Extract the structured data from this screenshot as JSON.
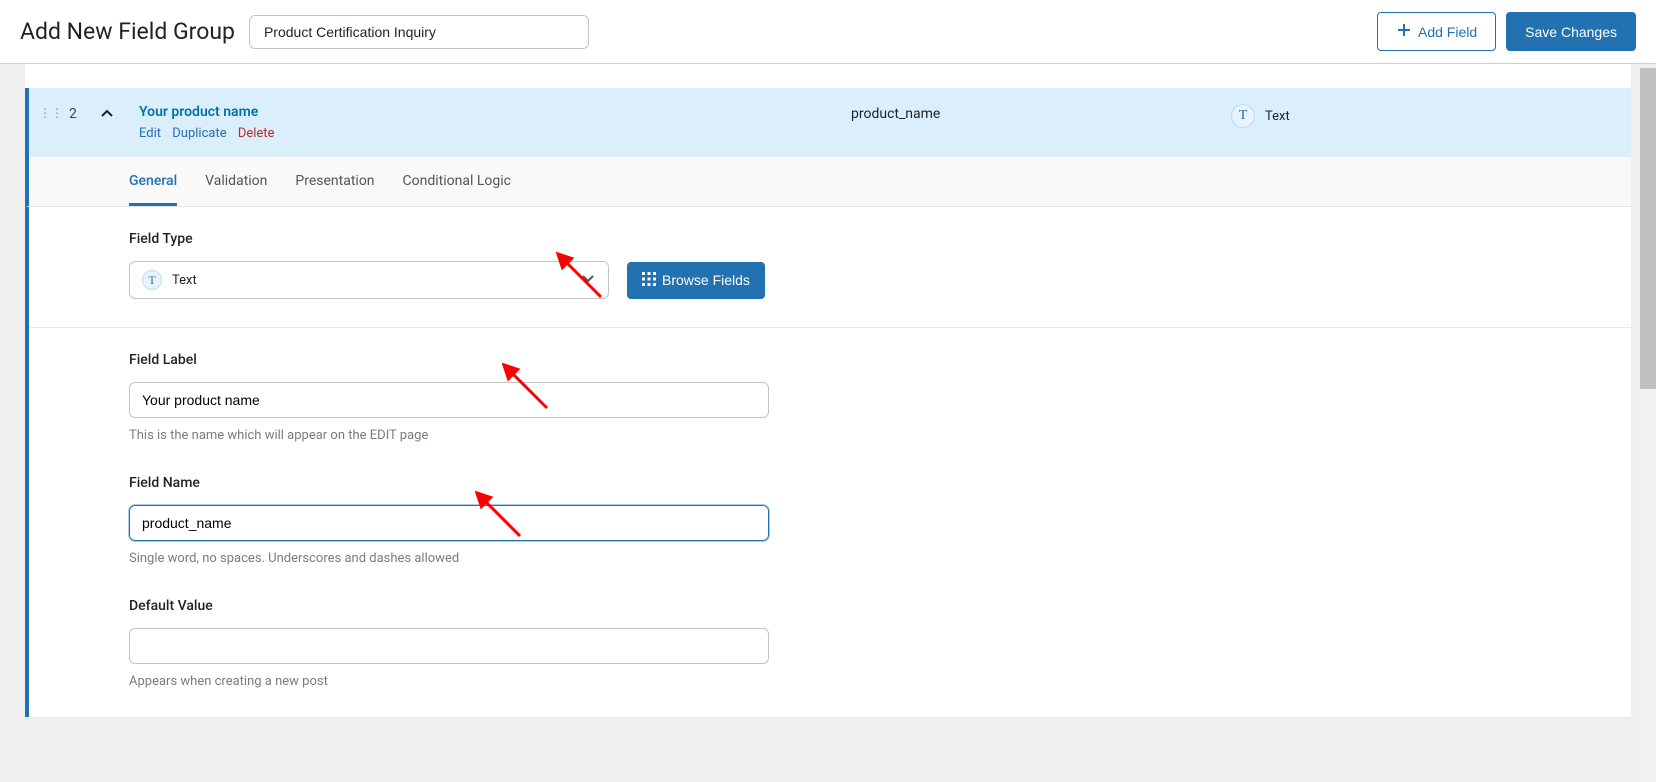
{
  "header": {
    "page_title": "Add New Field Group",
    "group_title_value": "Product Certification Inquiry",
    "add_field": "Add Field",
    "save_changes": "Save Changes"
  },
  "row": {
    "number": "2",
    "label": "Your product name",
    "actions": {
      "edit": "Edit",
      "duplicate": "Duplicate",
      "delete": "Delete"
    },
    "key": "product_name",
    "type_label": "Text"
  },
  "tabs": {
    "general": "General",
    "validation": "Validation",
    "presentation": "Presentation",
    "conditional": "Conditional Logic"
  },
  "settings": {
    "field_type": {
      "label": "Field Type",
      "value": "Text",
      "browse": "Browse Fields"
    },
    "field_label": {
      "label": "Field Label",
      "value": "Your product name",
      "help": "This is the name which will appear on the EDIT page"
    },
    "field_name": {
      "label": "Field Name",
      "value": "product_name",
      "help": "Single word, no spaces. Underscores and dashes allowed"
    },
    "default_value": {
      "label": "Default Value",
      "value": "",
      "help": "Appears when creating a new post"
    }
  }
}
